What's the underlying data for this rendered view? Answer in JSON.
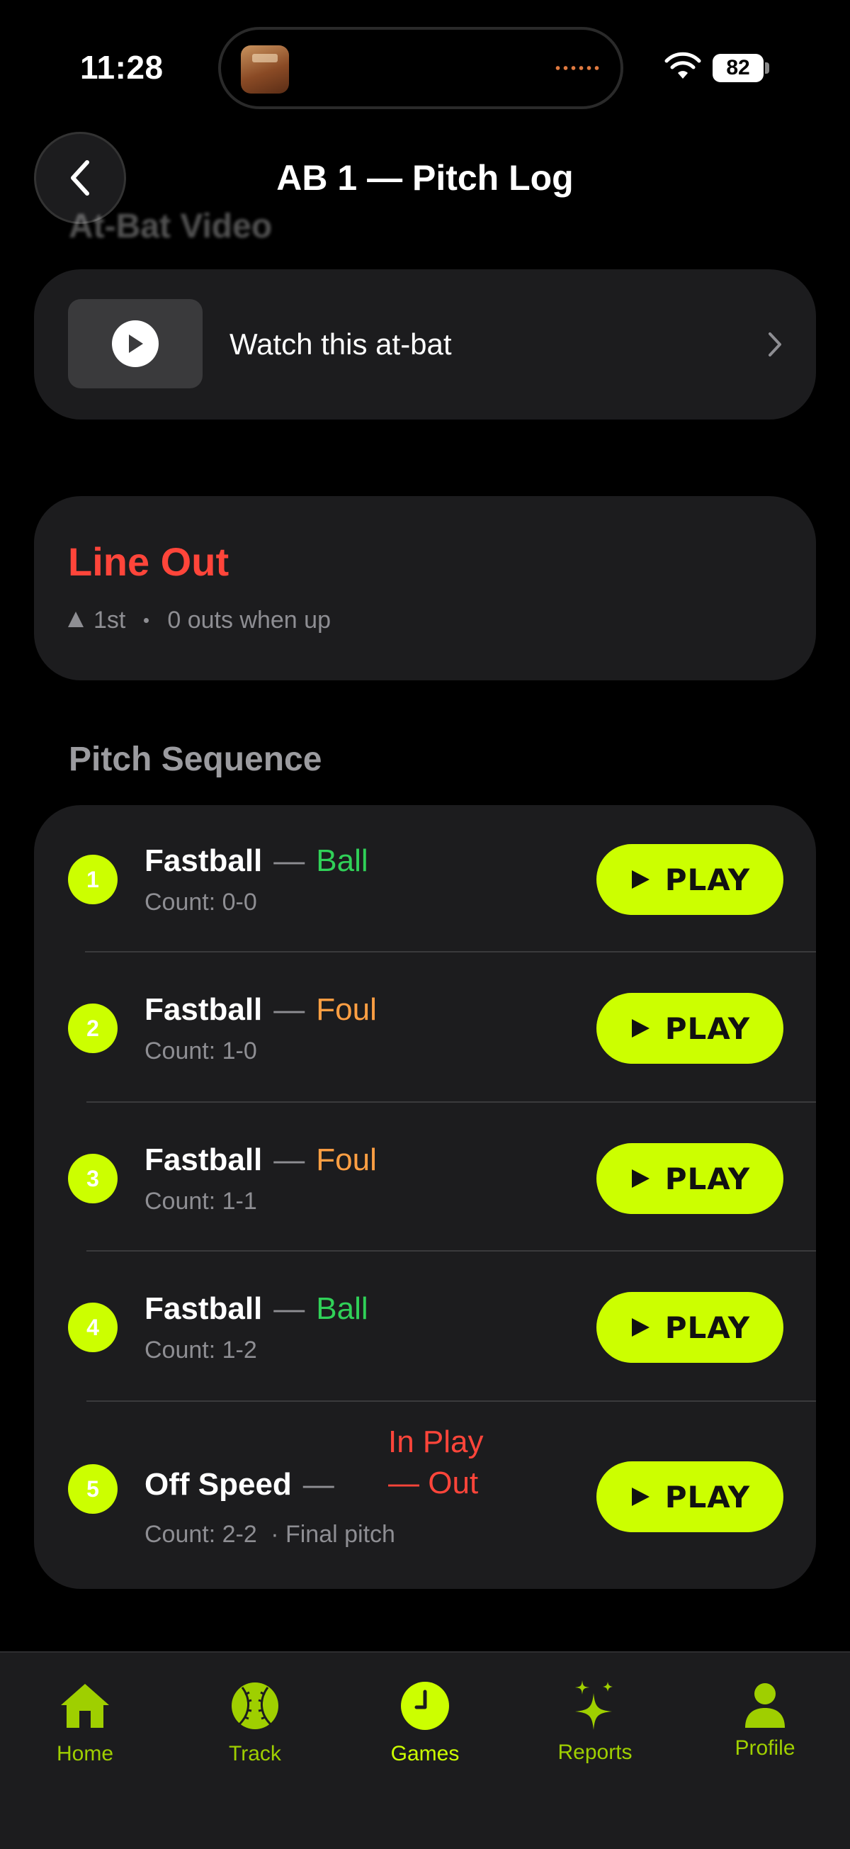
{
  "status_bar": {
    "time": "11:28",
    "battery": "82"
  },
  "header": {
    "title": "AB 1 — Pitch Log",
    "faded_section": "At-Bat Video"
  },
  "video": {
    "label": "Watch this at-bat"
  },
  "result": {
    "title": "Line Out",
    "base": "1st",
    "outs": "0 outs when up"
  },
  "sequence": {
    "heading": "Pitch Sequence",
    "play_label": "PLAY",
    "pitches": [
      {
        "num": "1",
        "type": "Fastball",
        "result": "Ball",
        "count": "Count: 0-0"
      },
      {
        "num": "2",
        "type": "Fastball",
        "result": "Foul",
        "count": "Count: 1-0"
      },
      {
        "num": "3",
        "type": "Fastball",
        "result": "Foul",
        "count": "Count: 1-1"
      },
      {
        "num": "4",
        "type": "Fastball",
        "result": "Ball",
        "count": "Count: 1-2"
      },
      {
        "num": "5",
        "type": "Off Speed",
        "result_line1": "In Play",
        "result_line2": "— Out",
        "count": "Count: 2-2",
        "note": "· Final pitch"
      }
    ]
  },
  "tabs": [
    {
      "label": "Home",
      "icon": "home-icon"
    },
    {
      "label": "Track",
      "icon": "baseball-icon"
    },
    {
      "label": "Games",
      "icon": "clock-icon"
    },
    {
      "label": "Reports",
      "icon": "sparkle-icon"
    },
    {
      "label": "Profile",
      "icon": "person-icon"
    }
  ],
  "colors": {
    "accent": "#ccff00",
    "ball": "#30d158",
    "foul": "#ff9f43",
    "out": "#ff453a",
    "card": "#1c1c1e"
  }
}
